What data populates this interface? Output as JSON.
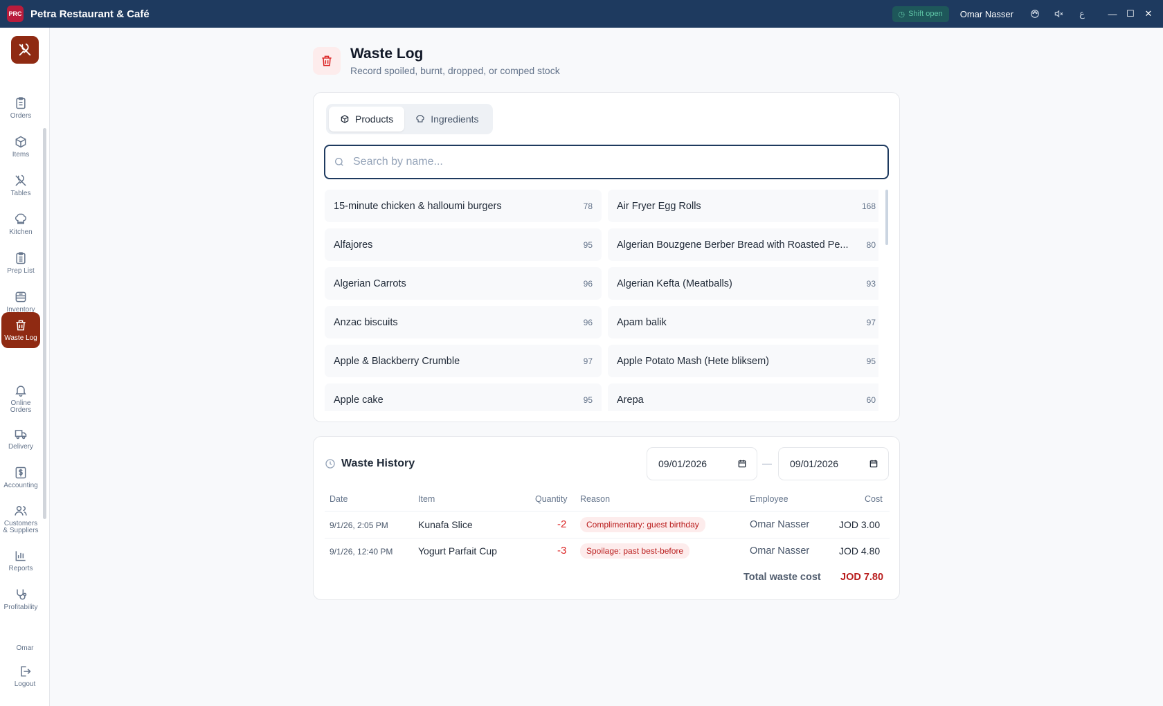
{
  "titlebar": {
    "app_title": "Petra Restaurant & Café",
    "logo_text": "PRC",
    "shift_status": "Shift open",
    "user_name": "Omar Nasser",
    "lang_label": "ع"
  },
  "sidebar": {
    "items": [
      {
        "label": "Orders",
        "icon": "clipboard-icon"
      },
      {
        "label": "Items",
        "icon": "box-icon"
      },
      {
        "label": "Tables",
        "icon": "utensils-icon"
      },
      {
        "label": "Kitchen",
        "icon": "chef-hat-icon"
      },
      {
        "label": "Prep List",
        "icon": "clipboard-list-icon"
      },
      {
        "label": "Inventory",
        "icon": "inventory-icon"
      },
      {
        "label": "Waste Log",
        "icon": "trash-icon"
      },
      {
        "label": "Online Orders",
        "icon": "bell-icon"
      },
      {
        "label": "Delivery",
        "icon": "truck-icon"
      },
      {
        "label": "Accounting",
        "icon": "dollar-icon"
      },
      {
        "label": "Customers & Suppliers",
        "icon": "users-icon"
      },
      {
        "label": "Reports",
        "icon": "bar-chart-icon"
      },
      {
        "label": "Profitability",
        "icon": "stethoscope-icon"
      }
    ],
    "active": "Waste Log",
    "footer_name": "Omar",
    "logout_label": "Logout"
  },
  "header": {
    "title": "Waste Log",
    "subtitle": "Record spoiled, burnt, dropped, or comped stock"
  },
  "tabs": [
    {
      "label": "Products",
      "active": true
    },
    {
      "label": "Ingredients",
      "active": false
    }
  ],
  "search": {
    "placeholder": "Search by name...",
    "value": ""
  },
  "products": [
    {
      "name": "15-minute chicken & halloumi burgers",
      "count": "78"
    },
    {
      "name": "Air Fryer Egg Rolls",
      "count": "168"
    },
    {
      "name": "Alfajores",
      "count": "95"
    },
    {
      "name": "Algerian Bouzgene Berber Bread with Roasted Pe...",
      "count": "80"
    },
    {
      "name": "Algerian Carrots",
      "count": "96"
    },
    {
      "name": "Algerian Kefta (Meatballs)",
      "count": "93"
    },
    {
      "name": "Anzac biscuits",
      "count": "96"
    },
    {
      "name": "Apam balik",
      "count": "97"
    },
    {
      "name": "Apple & Blackberry Crumble",
      "count": "97"
    },
    {
      "name": "Apple Potato Mash (Hete bliksem)",
      "count": "95"
    },
    {
      "name": "Apple cake",
      "count": "95"
    },
    {
      "name": "Arepa",
      "count": "60"
    }
  ],
  "history": {
    "title": "Waste History",
    "date_from": "09/01/2026",
    "date_to": "09/01/2026",
    "date_separator": "—",
    "columns": [
      "Date",
      "Item",
      "Quantity",
      "Reason",
      "Employee",
      "Cost"
    ],
    "rows": [
      {
        "date": "9/1/26, 2:05 PM",
        "item": "Kunafa Slice",
        "quantity": "-2",
        "reason": "Complimentary: guest birthday",
        "employee": "Omar Nasser",
        "cost": "JOD 3.00"
      },
      {
        "date": "9/1/26, 12:40 PM",
        "item": "Yogurt Parfait Cup",
        "quantity": "-3",
        "reason": "Spoilage: past best-before",
        "employee": "Omar Nasser",
        "cost": "JOD 4.80"
      }
    ],
    "total_label": "Total waste cost",
    "total_value": "JOD 7.80"
  },
  "colors": {
    "titlebar": "#1e3a5f",
    "accent": "#8f2a12",
    "danger": "#b91c1c"
  }
}
